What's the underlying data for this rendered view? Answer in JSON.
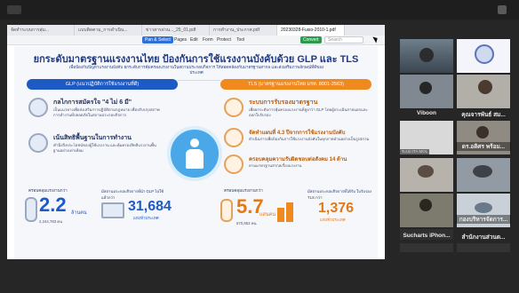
{
  "browser": {
    "tabs": [
      {
        "label": "จัดทำระบบการสุ่ม...",
        "active": false
      },
      {
        "label": "แบบติดตาม_การดำเนิน...",
        "active": false
      },
      {
        "label": "ข่าวสารด่วน..._25_01.pdf",
        "active": false
      },
      {
        "label": "การทำงาน_ประกาศ.pdf",
        "active": false
      },
      {
        "label": "20230328-Fusio-2010-1.pdf",
        "active": true
      }
    ],
    "toolbar": {
      "primary_button": "Pan & Select",
      "items": [
        "Pages",
        "Edit",
        "Form",
        "Protect",
        "Tool"
      ],
      "green_button": "Convert",
      "search_placeholder": "Search"
    }
  },
  "slide": {
    "title": "ยกระดับมาตรฐานแรงงานไทย ป้องกันการใช้แรงงานบังคับด้วย GLP และ TLS",
    "subtitle": "เพื่อป้องกันปัญหาแรงงานบังคับ ยกระดับการคุ้มครองแรงงานในสถานประกอบกิจการ ให้สอดคล้องกับมาตรฐานสากล และส่งเสริมภาพลักษณ์ที่ดีของประเทศ",
    "left_band": "GLP (แนวปฏิบัติการใช้แรงงานที่ดี)",
    "right_band": "TLS (มาตรฐานแรงงานไทย มรท. 8001-2563)",
    "left_rows": [
      {
        "head": "กลไกการสมัครใจ \"4 ไม่ 6 มี\"",
        "text": "เป็นแนวทางเพื่อส่งเสริมการปฏิบัติตามกฎหมาย เพื่อปรับปรุงสภาพการทำงานที่ปลอดภัยในสถานประกอบกิจการ"
      },
      {
        "head": "เน้นสิทธิพื้นฐานในการทำงาน",
        "text": "คำนึงถึงประโยชน์ของผู้ใช้แรงงาน และคุ้มครองสิทธิแรงงานพื้นฐานอย่างเท่าเทียม"
      }
    ],
    "right_rows": [
      {
        "head": "ระบบการรับรองมาตรฐาน",
        "text": "เพื่อยกระดับการคุ้มครองแรงงานที่สูงกว่า GLP โดยผู้ประเมินภายนอกและออกใบรับรอง"
      },
      {
        "head": "จัดทำแผนที่ 4.3 ปีจากการใช้แรงงานบังคับ",
        "text": "ดำเนินการเพื่อป้องกันการใช้แรงงานบังคับในทุกภาคส่วนอย่างเป็นรูปธรรม"
      },
      {
        "head": "ครอบคลุมความรับผิดชอบต่อสังคม 14 ด้าน",
        "text": "ตามมาตรฐานสากลเรื่องแรงงาน"
      }
    ],
    "stats": {
      "workers_label": "ครอบคลุมแรงงานกว่า",
      "workers_big": "2.2",
      "workers_unit": "ล้านคน",
      "workers_small": "2,244,783 คน",
      "glp_label": "มีสถานประกอบกิจการที่นำ GLP ไปใช้แล้วกว่า",
      "glp_big": "31,684",
      "glp_unit": "แห่งทั่วประเทศ",
      "tls_label": "ครอบคลุมแรงงานกว่า",
      "tls_big": "5.7",
      "tls_unit": "แสนคน",
      "tls_small": "570,853 คน",
      "tls_place_label": "มีสถานประกอบกิจการที่ได้รับ ใบรับรอง TLS กว่า",
      "tls_place_big": "1,376",
      "tls_place_unit": "แห่งทั่วประเทศ"
    }
  },
  "participants": [
    {
      "name": "",
      "tag": ""
    },
    {
      "name": "",
      "tag": ""
    },
    {
      "name": "Viboon",
      "tag": ""
    },
    {
      "name": "คุณจารพันธ์ สม...",
      "tag": ""
    },
    {
      "name": "",
      "tag": "ระบบ ITA MOL"
    },
    {
      "name": "ดร.อดิศร พร้อม...",
      "tag": ""
    },
    {
      "name": "",
      "tag": ""
    },
    {
      "name": "",
      "tag": ""
    },
    {
      "name": "",
      "tag": ""
    },
    {
      "name": "กองบริหารจัดการ...",
      "tag": ""
    },
    {
      "name": "Sucharts iPhon...",
      "tag": ""
    },
    {
      "name": "สำนักงานส่วนต...",
      "tag": ""
    }
  ],
  "colors": {
    "accent_blue": "#1d5ac3",
    "accent_orange": "#f08a1e",
    "background": "#262626"
  }
}
